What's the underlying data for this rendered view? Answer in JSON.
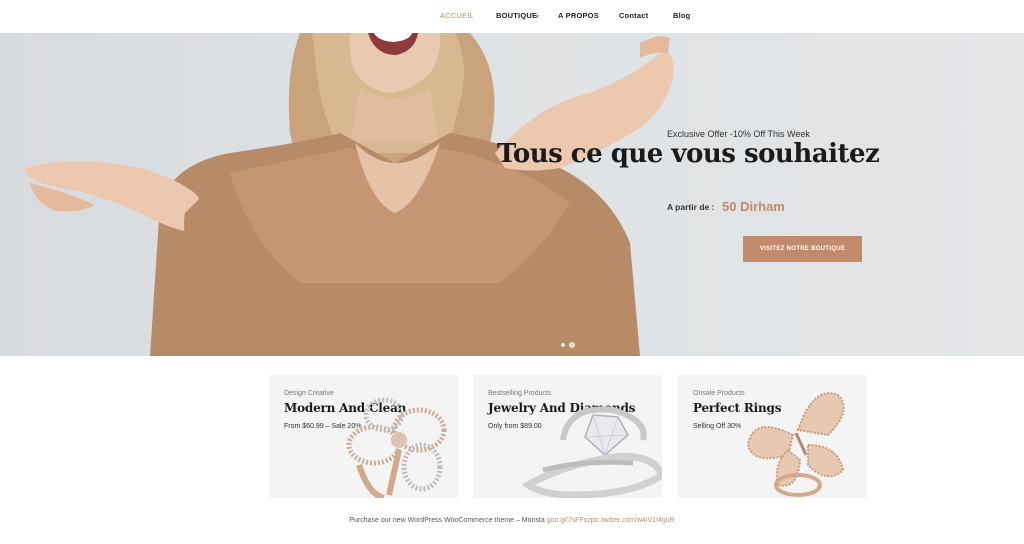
{
  "nav": {
    "items": [
      {
        "label": "ACCUEIL",
        "active": true
      },
      {
        "label": "BOUTIQUE",
        "active": false
      },
      {
        "label": "A PROPOS",
        "active": false
      },
      {
        "label": "Contact",
        "active": false
      },
      {
        "label": "Blog",
        "active": false
      }
    ],
    "dropdown_icon": "chevron-down-icon"
  },
  "hero": {
    "offer": "Exclusive Offer -10% Off This Week",
    "headline": "Tous ce que vous souhaitez",
    "from_label": "A partir de :",
    "price": "50 Dirham",
    "button": "VISITEZ NOTRE BOUTIQUE",
    "slides": 2,
    "active_slide": 2
  },
  "cards": [
    {
      "subtitle": "Design Creative",
      "title": "Modern And Clean",
      "desc": "From $60.99 – Sale 20%"
    },
    {
      "subtitle": "Bestselling Products",
      "title": "Jewelry And Diamonds",
      "desc": "Only from $89.00"
    },
    {
      "subtitle": "Onsale Products",
      "title": "Perfect Rings",
      "desc": "Selling Off 30%"
    }
  ],
  "footer": {
    "text": "Purchase our new WordPress WooCommerce theme – Monsta",
    "link": "goo.gl/7sFFxzpic.twitter.com/w4iV1I4guR"
  },
  "colors": {
    "accent": "#c08a6b",
    "sweater": "#b78a68",
    "hero_bg": "#dfe2e4",
    "card_bg": "#f4f4f4"
  }
}
